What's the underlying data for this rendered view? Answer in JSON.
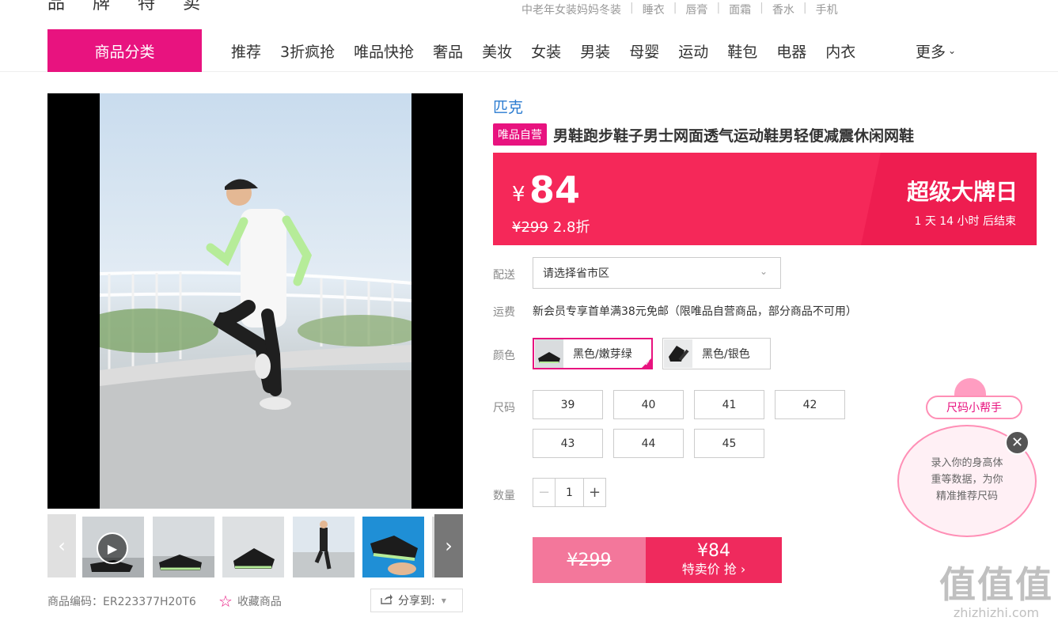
{
  "header": {
    "brand_cut_text": "品 牌 特 卖",
    "hot_links": [
      "中老年女装妈妈冬装",
      "睡衣",
      "唇膏",
      "面霜",
      "香水",
      "手机"
    ],
    "hot_sep": "|"
  },
  "nav": {
    "category_button": "商品分类",
    "items": [
      "推荐",
      "3折疯抢",
      "唯品快抢",
      "奢品",
      "美妆",
      "女装",
      "男装",
      "母婴",
      "运动",
      "鞋包",
      "电器",
      "内衣"
    ],
    "more": "更多",
    "more_icon": "chevron-down-icon",
    "accent_color": "#e8137f"
  },
  "gallery": {
    "prev_arrow": "‹",
    "next_arrow": "›",
    "play_icon": "▶",
    "item_code_label": "商品编码：",
    "item_code": "ER223377H20T6",
    "favorite_label": "收藏商品",
    "favorite_icon": "☆",
    "share_label": "分享到:",
    "share_icon": "share-icon"
  },
  "product": {
    "brand": "匹克",
    "self_badge": "唯品自营",
    "title": "男鞋跑步鞋子男士网面透气运动鞋男轻便减震休闲网鞋"
  },
  "price_box": {
    "currency": "¥",
    "price": "84",
    "original_price": "¥299",
    "discount": "2.8折",
    "event_title": "超级大牌日",
    "countdown": "1 天 14 小时 后结束",
    "bg_color": "#f52859"
  },
  "options": {
    "delivery_label": "配送",
    "region_placeholder": "请选择省市区",
    "shipping_label": "运费",
    "shipping_text": "新会员专享首单满38元免邮（限唯品自营商品，部分商品不可用）",
    "color_label": "颜色",
    "colors": [
      {
        "name": "黑色/嫩芽绿",
        "selected": true
      },
      {
        "name": "黑色/银色",
        "selected": false
      }
    ],
    "size_label": "尺码",
    "sizes": [
      "39",
      "40",
      "41",
      "42",
      "43",
      "44",
      "45"
    ],
    "quantity_label": "数量",
    "quantity": "1",
    "minus": "−",
    "plus": "+"
  },
  "buy_button": {
    "original": "¥299",
    "price": "¥84",
    "action": "特卖价 抢 ›"
  },
  "size_helper": {
    "title": "尺码小帮手",
    "text_lines": [
      "录入你的身高体",
      "重等数据，为你",
      "精准推荐尺码"
    ],
    "close": "✕"
  },
  "watermark": {
    "big": "值值值",
    "small": "zhizhizhi.com"
  }
}
